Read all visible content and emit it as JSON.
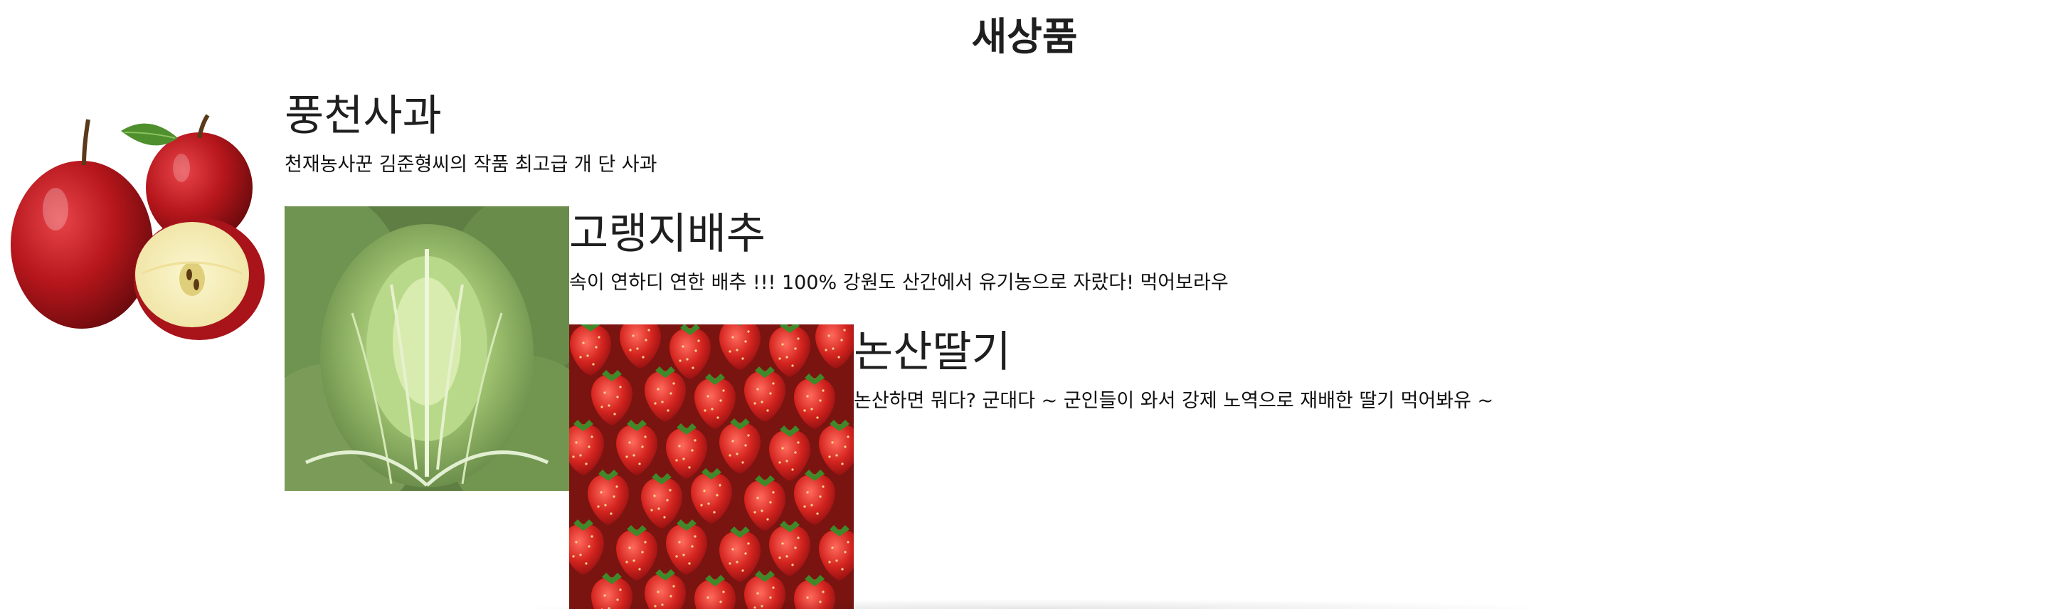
{
  "page": {
    "title": "새상품"
  },
  "products": [
    {
      "name": "풍천사과",
      "description": "천재농사꾼 김준형씨의 작품 최고급 개 단 사과",
      "image_icon": "apple-image"
    },
    {
      "name": "고랭지배추",
      "description": "속이 연하디 연한 배추 !!! 100% 강원도 산간에서 유기농으로 자랐다! 먹어보라우",
      "image_icon": "napa-cabbage-image"
    },
    {
      "name": "논산딸기",
      "description": "논산하면 뭐다? 군대다 ~ 군인들이 와서 강제 노역으로 재배한 딸기 먹어봐유 ~",
      "image_icon": "strawberries-image"
    }
  ],
  "colors": {
    "background": "#ffffff",
    "text": "#222222",
    "apple_red": "#b5161b",
    "cabbage_green": "#7fa760",
    "strawberry_red": "#d4241f"
  }
}
